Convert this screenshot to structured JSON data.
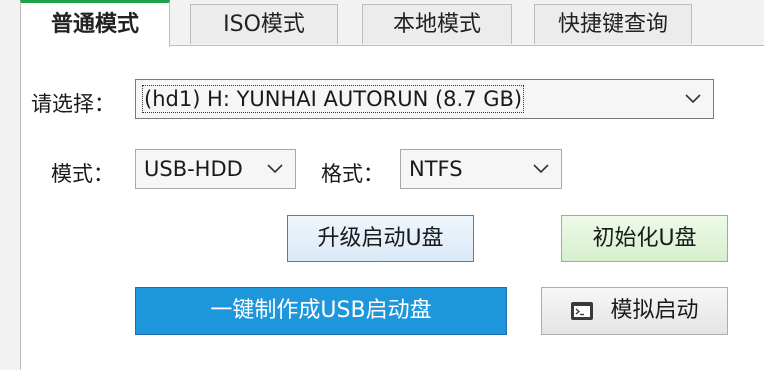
{
  "tabs": [
    {
      "label": "普通模式",
      "active": true
    },
    {
      "label": "ISO模式",
      "active": false
    },
    {
      "label": "本地模式",
      "active": false
    },
    {
      "label": "快捷键查询",
      "active": false
    }
  ],
  "device": {
    "label": "请选择：",
    "value": "(hd1) H: YUNHAI AUTORUN (8.7 GB)"
  },
  "mode": {
    "label": "模式：",
    "value": "USB-HDD"
  },
  "format": {
    "label": "格式：",
    "value": "NTFS"
  },
  "buttons": {
    "upgrade": "升级启动U盘",
    "init": "初始化U盘",
    "create": "一键制作成USB启动盘",
    "simulate": "模拟启动"
  },
  "colors": {
    "active_tab_accent": "#1fa34a",
    "primary_button": "#1e96dc",
    "init_button": "#d6f0cd",
    "upgrade_border": "#2a8ad4"
  },
  "icons": {
    "dropdown": "chevron-down-icon",
    "simulate": "terminal-icon"
  }
}
